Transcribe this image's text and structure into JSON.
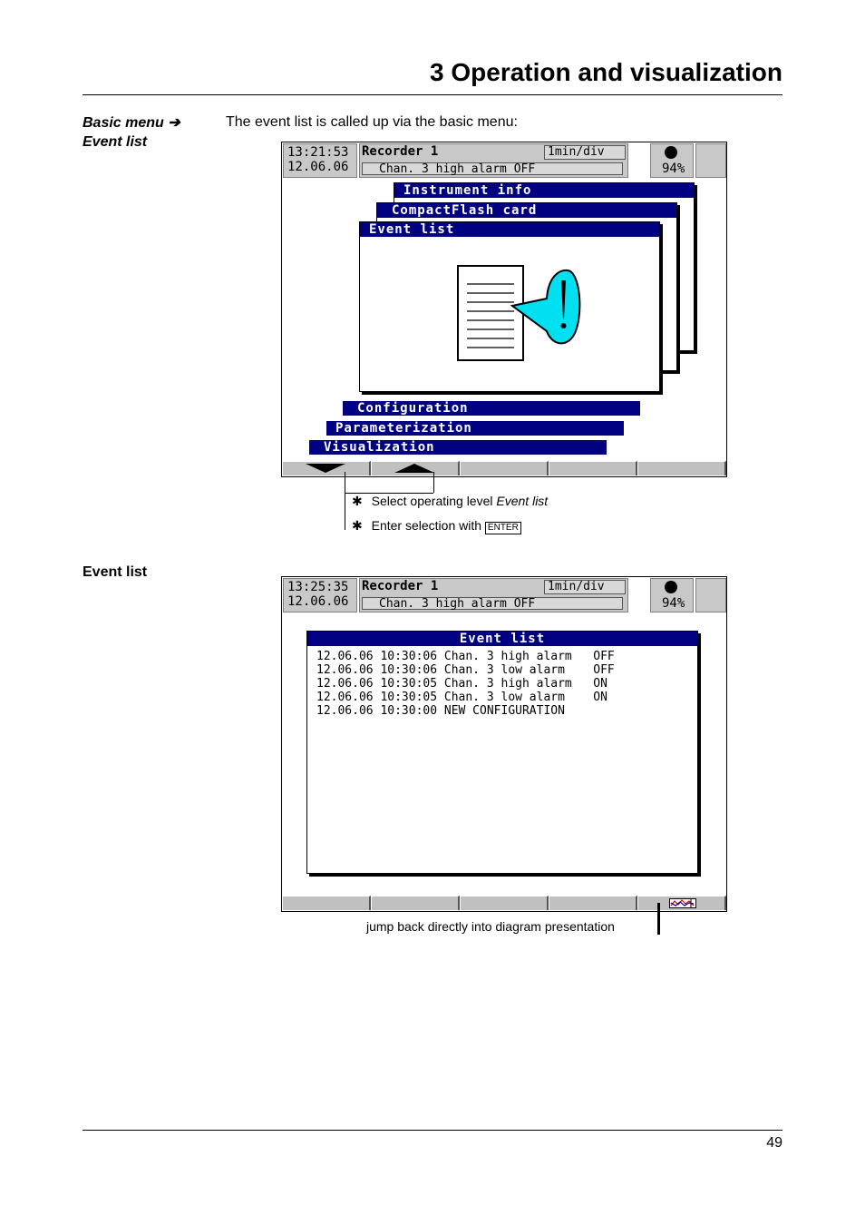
{
  "header": {
    "title": "3 Operation and visualization"
  },
  "section1": {
    "side_line1": "Basic menu ➔",
    "side_line2": "Event list",
    "intro": "The event list is called up via the basic menu:"
  },
  "screen1": {
    "time": "13:21:53",
    "date": "12.06.06",
    "recorder": "Recorder  1",
    "rate": "1min/div",
    "status": "Chan. 3 high alarm   OFF",
    "memory": "94%",
    "menu": {
      "instrument_info": "Instrument  info",
      "compactflash": "CompactFlash  card",
      "event_list": "Event  list",
      "configuration": "Configuration",
      "parameterization": "Parameterization",
      "visualization": "Visualization"
    }
  },
  "callouts1": {
    "bullet": "✱",
    "line1_prefix": "Select operating level ",
    "line1_italic": "Event list",
    "line2_prefix": "Enter selection with ",
    "enter_key": "ENTER"
  },
  "section2": {
    "side": "Event list"
  },
  "screen2": {
    "time": "13:25:35",
    "date": "12.06.06",
    "recorder": "Recorder  1",
    "rate": "1min/div",
    "status": "Chan. 3 high alarm   OFF",
    "memory": "94%",
    "window_title": "Event  list",
    "events": [
      "12.06.06 10:30:06 Chan. 3 high alarm   OFF",
      "12.06.06 10:30:06 Chan. 3 low alarm    OFF",
      "12.06.06 10:30:05 Chan. 3 high alarm   ON",
      "12.06.06 10:30:05 Chan. 3 low alarm    ON",
      "12.06.06 10:30:00 NEW CONFIGURATION"
    ]
  },
  "callout2": "jump back directly into diagram presentation",
  "footer": {
    "page_number": "49"
  },
  "colors": {
    "menu_bar": "#000080",
    "speech_bubble": "#00e0f0"
  }
}
